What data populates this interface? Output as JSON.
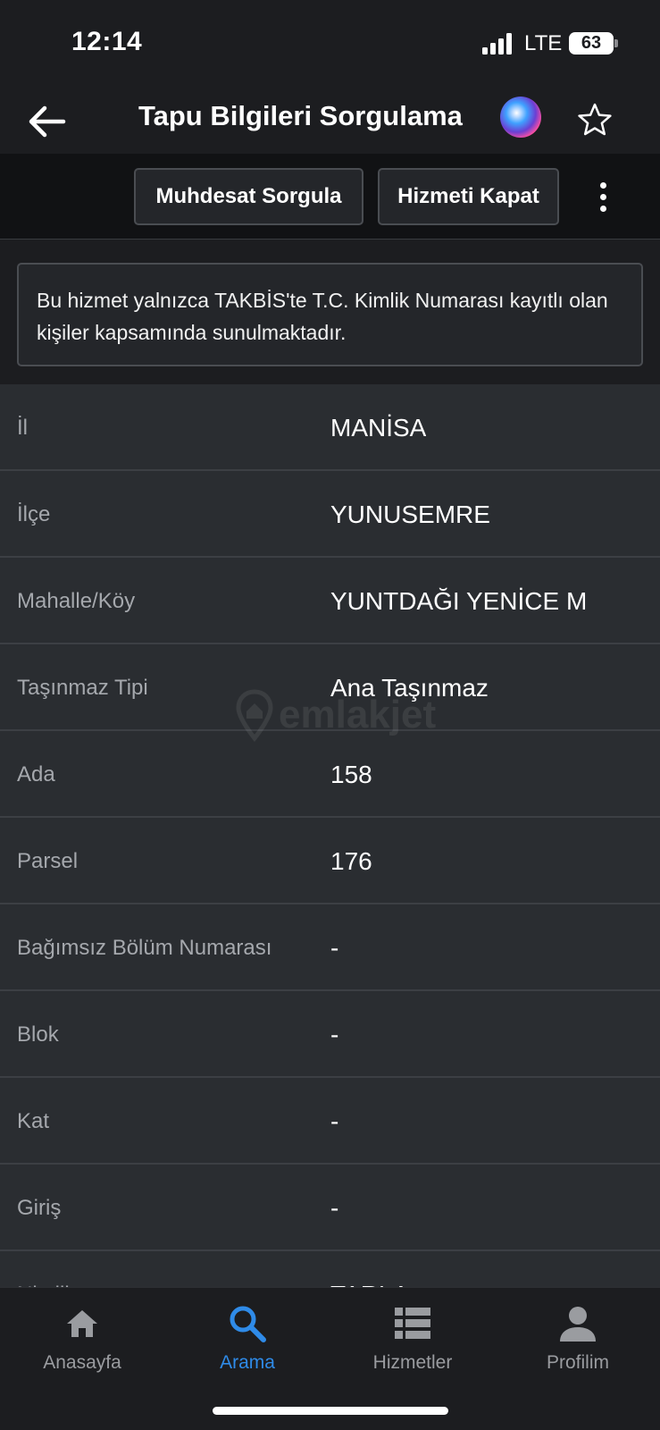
{
  "status_bar": {
    "time": "12:14",
    "network": "LTE",
    "battery": "63"
  },
  "nav": {
    "title": "Tapu Bilgileri Sorgulama",
    "back_icon": "arrow-left-icon",
    "siri_icon": "siri-icon",
    "favorite_icon": "star-outline-icon"
  },
  "toolbar": {
    "muhdesat_label": "Muhdesat Sorgula",
    "kapat_label": "Hizmeti Kapat",
    "more_icon": "more-vertical-icon"
  },
  "info": {
    "text": "Bu hizmet yalnızca TAKBİS'te T.C. Kimlik Numarası kayıtlı olan kişiler kapsamında sunulmaktadır."
  },
  "details": [
    {
      "label": "İl",
      "value": "MANİSA"
    },
    {
      "label": "İlçe",
      "value": "YUNUSEMRE"
    },
    {
      "label": "Mahalle/Köy",
      "value": "YUNTDAĞI YENİCE M"
    },
    {
      "label": "Taşınmaz Tipi",
      "value": "Ana Taşınmaz"
    },
    {
      "label": "Ada",
      "value": "158"
    },
    {
      "label": "Parsel",
      "value": "176"
    },
    {
      "label": "Bağımsız Bölüm Numarası",
      "value": "-"
    },
    {
      "label": "Blok",
      "value": "-"
    },
    {
      "label": "Kat",
      "value": "-"
    },
    {
      "label": "Giriş",
      "value": "-"
    },
    {
      "label": "Nitelik",
      "value": "TARLA"
    }
  ],
  "watermark": "emlakjet",
  "tabs": [
    {
      "label": "Anasayfa",
      "icon": "home-icon",
      "active": false
    },
    {
      "label": "Arama",
      "icon": "search-icon",
      "active": true
    },
    {
      "label": "Hizmetler",
      "icon": "list-icon",
      "active": false
    },
    {
      "label": "Profilim",
      "icon": "person-icon",
      "active": false
    }
  ],
  "colors": {
    "background": "#1c1d20",
    "row_background": "#2a2d31",
    "accent": "#2f8be8",
    "label": "#a5a8ad"
  }
}
